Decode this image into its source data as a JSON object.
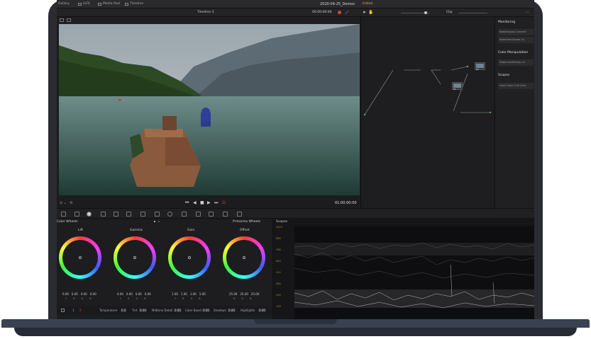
{
  "menubar": {
    "tabs": [
      {
        "label": "Gallery",
        "icon": "gallery-icon"
      },
      {
        "label": "LUTs",
        "icon": "luts-icon"
      },
      {
        "label": "Media Pool",
        "icon": "media-pool-icon"
      },
      {
        "label": "Timeline",
        "icon": "timeline-icon"
      }
    ],
    "project_title": "2020-04-25_Demos",
    "status": "Edited"
  },
  "toolbar": {
    "timeline_name": "Timeline 3",
    "timecode": "00:00:00:00",
    "clip_label": "Clip"
  },
  "transport": {
    "timecode_out": "01:00:00:00"
  },
  "node_graph": {
    "nodes": [
      "01",
      "02",
      "03",
      "05",
      "06"
    ]
  },
  "side_panel": {
    "monitoring_header": "Monitoring",
    "monitoring_items": [
      "NobeDisplay Connect",
      "NobeOmniScope Co"
    ],
    "color_manipulation_header": "Color Manipulation",
    "color_manipulation_items": [
      "NobeColorRemap Co"
    ],
    "scopes_header": "Scopes",
    "scopes_items": [
      "False Color 3.00 (Sim"
    ]
  },
  "color_wheels": {
    "header": "Color Wheels",
    "mode": "Primaries Wheels",
    "wheels": [
      {
        "label": "Lift",
        "values": [
          "0.00",
          "0.00",
          "0.00",
          "0.00"
        ]
      },
      {
        "label": "Gamma",
        "values": [
          "0.00",
          "0.00",
          "0.00",
          "0.00"
        ]
      },
      {
        "label": "Gain",
        "values": [
          "1.00",
          "1.00",
          "1.00",
          "1.00"
        ]
      },
      {
        "label": "Offset",
        "values": [
          "25.00",
          "25.00",
          "25.00",
          ""
        ]
      }
    ],
    "channel_letters": [
      "Y",
      "R",
      "G",
      "B"
    ]
  },
  "params": {
    "page_1": "1",
    "page_2": "2",
    "temperature_label": "Temperature",
    "temperature_value": "0.0",
    "tint_label": "Tint",
    "tint_value": "0.00",
    "midtone_label": "Midtone Detail",
    "midtone_value": "0.00",
    "color_boost_label": "Color Boost",
    "color_boost_value": "0.00",
    "shadows_label": "Shadows",
    "shadows_value": "0.00",
    "highlights_label": "Highlights",
    "highlights_value": "0.00"
  },
  "scopes": {
    "header": "Scopes",
    "scale": [
      "1023",
      "896",
      "768",
      "640",
      "512",
      "384",
      "256",
      "128"
    ]
  },
  "colors": {
    "accent_status": "#e0a83a",
    "panel_bg": "#1d1d1f",
    "laptop_body": "#2a2c31"
  }
}
